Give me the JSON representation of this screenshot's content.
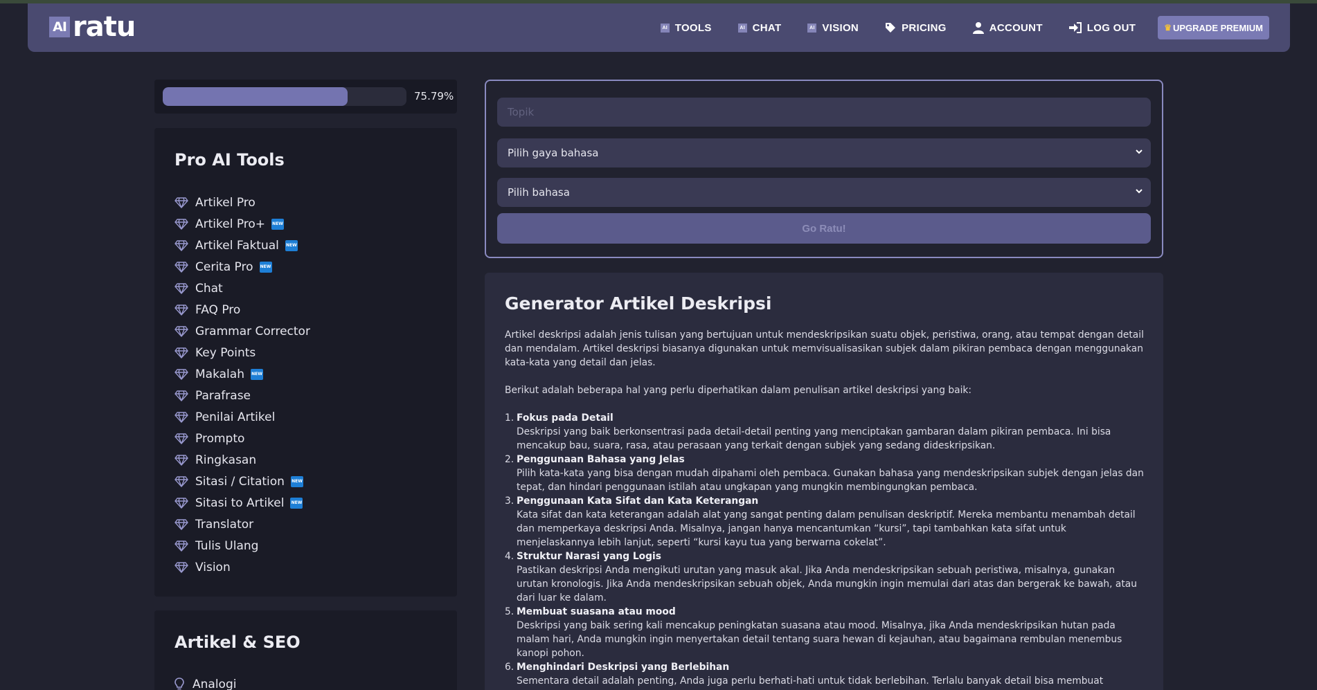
{
  "brand": {
    "logo_box": "AI",
    "logo_text": "ratu"
  },
  "nav": [
    {
      "label": "TOOLS",
      "icon": "ai-icon"
    },
    {
      "label": "CHAT",
      "icon": "ai-icon"
    },
    {
      "label": "VISION",
      "icon": "ai-icon"
    },
    {
      "label": "PRICING",
      "icon": "tag-icon"
    },
    {
      "label": "ACCOUNT",
      "icon": "user-icon"
    },
    {
      "label": "LOG OUT",
      "icon": "logout-icon"
    }
  ],
  "upgrade_label": "UPGRADE PREMIUM",
  "new_badge": "NEW",
  "progress": {
    "value": 0.7579,
    "label": "75.79%"
  },
  "sidebar": {
    "tools_title": "Pro AI Tools",
    "tools": [
      {
        "label": "Artikel Pro",
        "new": false
      },
      {
        "label": "Artikel Pro+",
        "new": true
      },
      {
        "label": "Artikel Faktual",
        "new": true
      },
      {
        "label": "Cerita Pro",
        "new": true
      },
      {
        "label": "Chat",
        "new": false
      },
      {
        "label": "FAQ Pro",
        "new": false
      },
      {
        "label": "Grammar Corrector",
        "new": false
      },
      {
        "label": "Key Points",
        "new": false
      },
      {
        "label": "Makalah",
        "new": true
      },
      {
        "label": "Parafrase",
        "new": false
      },
      {
        "label": "Penilai Artikel",
        "new": false
      },
      {
        "label": "Prompto",
        "new": false
      },
      {
        "label": "Ringkasan",
        "new": false
      },
      {
        "label": "Sitasi / Citation",
        "new": true
      },
      {
        "label": "Sitasi to Artikel",
        "new": true
      },
      {
        "label": "Translator",
        "new": false
      },
      {
        "label": "Tulis Ulang",
        "new": false
      },
      {
        "label": "Vision",
        "new": false
      }
    ],
    "seo_title": "Artikel & SEO",
    "seo_first_item": "Analogi"
  },
  "form": {
    "topic_placeholder": "Topik",
    "style_select": "Pilih gaya bahasa",
    "language_select": "Pilih bahasa",
    "submit_label": "Go Ratu!"
  },
  "article": {
    "title": "Generator Artikel Deskripsi",
    "intro": "Artikel deskripsi adalah jenis tulisan yang bertujuan untuk mendeskripsikan suatu objek, peristiwa, orang, atau tempat dengan detail dan mendalam. Artikel deskripsi biasanya digunakan untuk memvisualisasikan subjek dalam pikiran pembaca dengan menggunakan kata-kata yang detail dan jelas.",
    "lead": "Berikut adalah beberapa hal yang perlu diperhatikan dalam penulisan artikel deskripsi yang baik:",
    "points": [
      {
        "num": "1.",
        "title": "Fokus pada Detail",
        "text": "Deskripsi yang baik berkonsentrasi pada detail-detail penting yang menciptakan gambaran dalam pikiran pembaca. Ini bisa mencakup bau, suara, rasa, atau perasaan yang terkait dengan subjek yang sedang dideskripsikan."
      },
      {
        "num": "2.",
        "title": "Penggunaan Bahasa yang Jelas",
        "text": "Pilih kata-kata yang bisa dengan mudah dipahami oleh pembaca. Gunakan bahasa yang mendeskripsikan subjek dengan jelas dan tepat, dan hindari penggunaan istilah atau ungkapan yang mungkin membingungkan pembaca."
      },
      {
        "num": "3.",
        "title": "Penggunaan Kata Sifat dan Kata Keterangan",
        "text": "Kata sifat dan kata keterangan adalah alat yang sangat penting dalam penulisan deskriptif. Mereka membantu menambah detail dan memperkaya deskripsi Anda. Misalnya, jangan hanya mencantumkan “kursi”, tapi tambahkan kata sifat untuk menjelaskannya lebih lanjut, seperti “kursi kayu tua yang berwarna cokelat”."
      },
      {
        "num": "4.",
        "title": "Struktur Narasi yang Logis",
        "text": "Pastikan deskripsi Anda mengikuti urutan yang masuk akal. Jika Anda mendeskripsikan sebuah peristiwa, misalnya, gunakan urutan kronologis. Jika Anda mendeskripsikan sebuah objek, Anda mungkin ingin memulai dari atas dan bergerak ke bawah, atau dari luar ke dalam."
      },
      {
        "num": "5.",
        "title": "Membuat suasana atau mood",
        "text": "Deskripsi yang baik sering kali mencakup peningkatan suasana atau mood. Misalnya, jika Anda mendeskripsikan hutan pada malam hari, Anda mungkin ingin menyertakan detail tentang suara hewan di kejauhan, atau bagaimana rembulan menembus kanopi pohon."
      },
      {
        "num": "6.",
        "title": "Menghindari Deskripsi yang Berlebihan",
        "text": "Sementara detail adalah penting, Anda juga perlu berhati-hati untuk tidak berlebihan. Terlalu banyak detail bisa membuat pembaca merasa kewalahan dan dapat menyebabkan deskripsi Anda menjadi membosankan atau sulit diikuti."
      }
    ]
  }
}
